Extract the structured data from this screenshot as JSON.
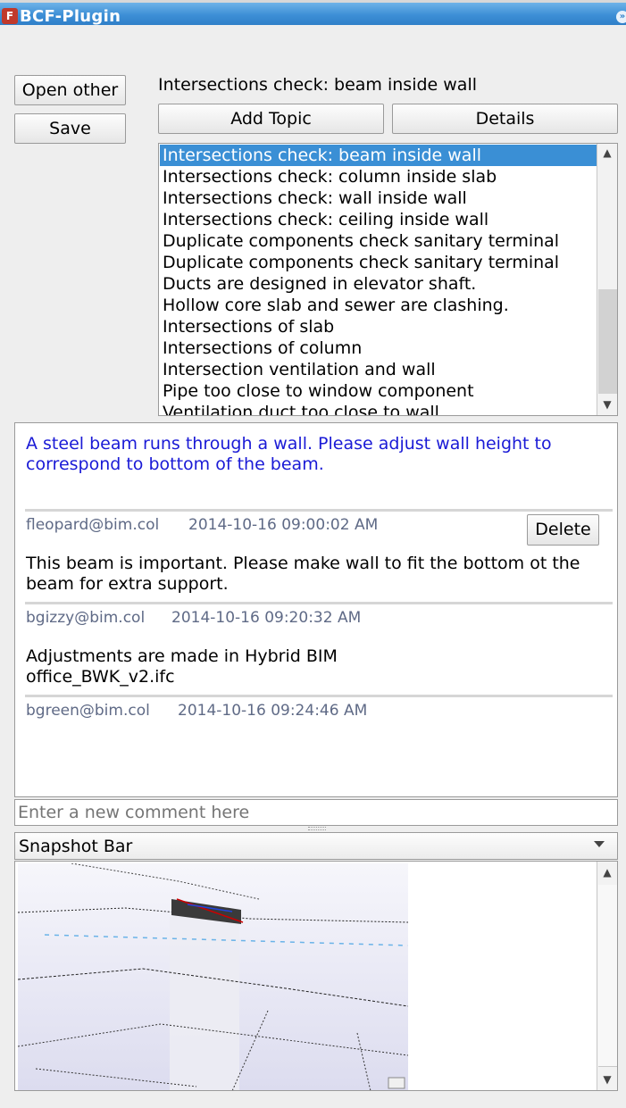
{
  "window": {
    "title": "BCF-Plugin",
    "icon": "bcf-plugin-icon",
    "collapse_icon": "collapse-icon"
  },
  "left_buttons": {
    "open_other": "Open other",
    "save": "Save"
  },
  "topic": {
    "current_title": "Intersections check: beam inside wall",
    "add_topic": "Add Topic",
    "details": "Details"
  },
  "topic_list": {
    "selected_index": 0,
    "items": [
      "Intersections check: beam inside wall",
      "Intersections check: column inside slab",
      "Intersections check: wall inside wall",
      "Intersections check: ceiling inside wall",
      "Duplicate components check sanitary terminal",
      "Duplicate components check sanitary terminal",
      "Ducts are designed in elevator shaft.",
      "Hollow core slab and sewer are clashing.",
      "Intersections of slab",
      "Intersections of column",
      "Intersection ventilation and wall",
      "Pipe too close to window component",
      "Ventilation duct too close to wall"
    ]
  },
  "description": "A steel beam runs through a wall. Please adjust wall height to correspond to bottom of the beam.",
  "comments": [
    {
      "author": "fleopard@bim.col",
      "timestamp": "2014-10-16 09:00:02 AM",
      "delete_label": "Delete",
      "text": "This beam is important. Please make wall to fit the bottom ot the beam for extra support."
    },
    {
      "author": "bgizzy@bim.col",
      "timestamp": "2014-10-16 09:20:32 AM",
      "text": "Adjustments are made in Hybrid BIM office_BWK_v2.ifc"
    },
    {
      "author": "bgreen@bim.col",
      "timestamp": "2014-10-16 09:24:46 AM",
      "text": ""
    }
  ],
  "new_comment": {
    "placeholder": "Enter a new comment here",
    "value": ""
  },
  "snapshot_bar": {
    "label": "Snapshot Bar",
    "dropdown_icon": "chevron-down-icon"
  },
  "colors": {
    "titlebar": "#3d8fd6",
    "selection": "#3a8fd5",
    "description_text": "#1a1ad6",
    "meta_text": "#5f6a86"
  }
}
